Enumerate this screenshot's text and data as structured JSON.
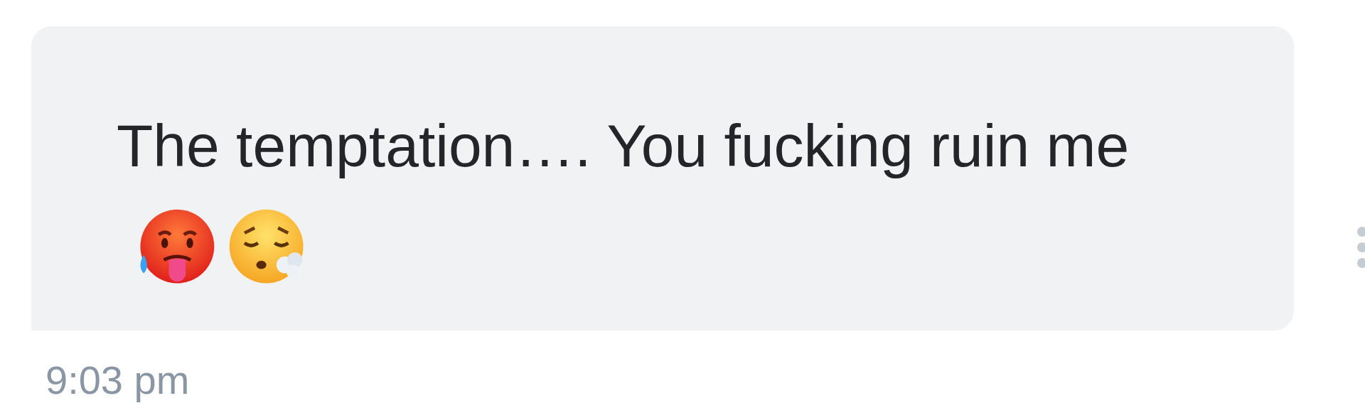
{
  "message": {
    "text": "The temptation…. You fucking ruin me",
    "time": "9:03 pm"
  }
}
